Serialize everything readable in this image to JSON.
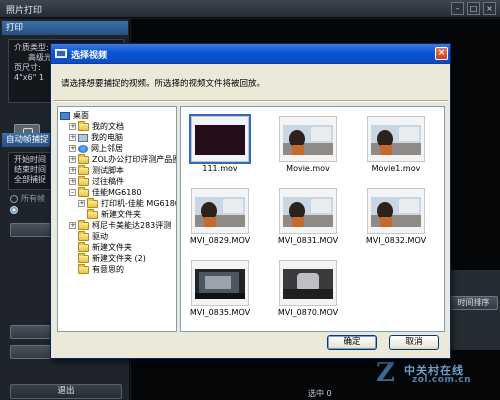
{
  "window": {
    "title": "照片打印",
    "min_glyph": "–",
    "max_glyph": "□",
    "close_glyph": "×"
  },
  "left_panel": {
    "print_section": "打印",
    "print_info": [
      "介质类型:",
      "高级光",
      "页尺寸:",
      "4\"x6\" 1"
    ],
    "auto_section": "自动帧捕捉",
    "auto_info": [
      "开始时间",
      "结束时间",
      "全部捕捉"
    ],
    "radio_all": "所有帧",
    "exit_label": "退出"
  },
  "main": {
    "sort_button": "时间排序",
    "selected_count": "选中 0",
    "watermark_brand": "中关村在线",
    "watermark_url": "zol.com.cn",
    "watermark_mark": "Z"
  },
  "dialog": {
    "title": "选择视频",
    "close_glyph": "×",
    "instruction": "请选择想要捕捉的视频。所选择的视频文件将被回放。",
    "tree": [
      {
        "label": "桌面",
        "icon": "desktop-icon",
        "expander": "",
        "level": 0,
        "selected": false
      },
      {
        "label": "我的文档",
        "icon": "folder-icon",
        "expander": "+",
        "level": 1,
        "selected": false
      },
      {
        "label": "我的电脑",
        "icon": "computer-icon",
        "expander": "+",
        "level": 1,
        "selected": false
      },
      {
        "label": "网上邻居",
        "icon": "network-icon",
        "expander": "+",
        "level": 1,
        "selected": false
      },
      {
        "label": "ZOL办公打印评测产品图",
        "icon": "folder-icon",
        "expander": "+",
        "level": 1,
        "selected": false
      },
      {
        "label": "测试脚本",
        "icon": "folder-icon",
        "expander": "+",
        "level": 1,
        "selected": false
      },
      {
        "label": "过往稿件",
        "icon": "folder-icon",
        "expander": "+",
        "level": 1,
        "selected": false
      },
      {
        "label": "佳能MG6180",
        "icon": "folder-icon",
        "expander": "–",
        "level": 1,
        "selected": false
      },
      {
        "label": "打印机-佳能 MG6180-黑色",
        "icon": "folder-icon",
        "expander": "+",
        "level": 2,
        "selected": false
      },
      {
        "label": "新建文件夹",
        "icon": "folder-icon",
        "expander": "",
        "level": 2,
        "selected": false
      },
      {
        "label": "柯尼卡美能达283评测",
        "icon": "folder-icon",
        "expander": "+",
        "level": 1,
        "selected": false
      },
      {
        "label": "驱动",
        "icon": "folder-icon",
        "expander": "",
        "level": 1,
        "selected": false
      },
      {
        "label": "新建文件夹",
        "icon": "folder-icon",
        "expander": "",
        "level": 1,
        "selected": false
      },
      {
        "label": "新建文件夹 (2)",
        "icon": "folder-icon",
        "expander": "",
        "level": 1,
        "selected": false
      },
      {
        "label": "有意思的",
        "icon": "folder-icon",
        "expander": "",
        "level": 1,
        "selected": false
      }
    ],
    "thumbnails": [
      {
        "name": "111.mov",
        "selected": true,
        "theme": "dark"
      },
      {
        "name": "Movie.mov",
        "selected": false,
        "theme": "office"
      },
      {
        "name": "Movie1.mov",
        "selected": false,
        "theme": "office"
      },
      {
        "name": "MVI_0829.MOV",
        "selected": false,
        "theme": "office"
      },
      {
        "name": "MVI_0831.MOV",
        "selected": false,
        "theme": "office"
      },
      {
        "name": "MVI_0832.MOV",
        "selected": false,
        "theme": "office"
      },
      {
        "name": "MVI_0835.MOV",
        "selected": false,
        "theme": "screen"
      },
      {
        "name": "MVI_0870.MOV",
        "selected": false,
        "theme": "blur"
      }
    ],
    "ok_label": "确定",
    "cancel_label": "取消"
  }
}
